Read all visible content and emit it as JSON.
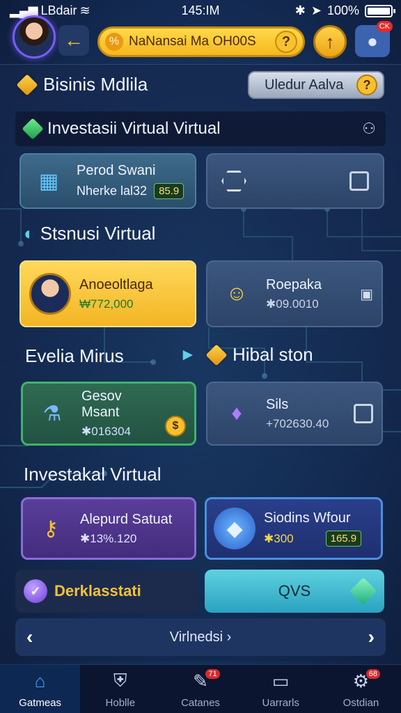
{
  "status_bar": {
    "carrier": "LBdair",
    "time": "145:IM",
    "battery": "100%"
  },
  "header": {
    "search_text": "NaNansai Ma OH00S",
    "search_icon_glyph": "%",
    "help_glyph": "?",
    "up_glyph": "↑",
    "profile_badge": "CK"
  },
  "business": {
    "title": "Bisinis Mdlila",
    "button_label": "Uledur Aalva",
    "button_glyph": "?"
  },
  "virtual_bar": {
    "label": "Investasii Virtual Virtual"
  },
  "row1": {
    "card1": {
      "title": "Perod Swani",
      "subtitle": "Nherke lal32",
      "chip": "85.9"
    }
  },
  "section2": {
    "title": "Stsnusi Virtual"
  },
  "row2": {
    "card1": {
      "title": "Anoeoltlaga",
      "value": "₩772,000"
    },
    "card2": {
      "title": "Roepaka",
      "value": "✱09.0010"
    }
  },
  "section3": {
    "left_title": "Evelia Mirus",
    "right_title": "Hibal ston"
  },
  "row3": {
    "card1": {
      "title": "Gesov Msant",
      "value": "✱016304"
    },
    "card2": {
      "title": "Sils",
      "value": "+702630.40"
    }
  },
  "section4": {
    "title": "Investakal Virtual"
  },
  "row4": {
    "card1": {
      "title": "Alepurd Satuat",
      "value": "✱13%.120"
    },
    "card2": {
      "title": "Siodins Wfour",
      "value": "✱300",
      "chip": "165.9"
    }
  },
  "actions": {
    "left_label": "Derklasstati",
    "right_label": "QVS"
  },
  "pager": {
    "label": "Virlnedsi",
    "prev": "‹",
    "next": "›"
  },
  "nav": [
    {
      "label": "Gatmeas",
      "icon": "home-icon",
      "badge": ""
    },
    {
      "label": "Hoblle",
      "icon": "shield-icon",
      "badge": ""
    },
    {
      "label": "Catanes",
      "icon": "tag-icon",
      "badge": "71"
    },
    {
      "label": "Uarrarls",
      "icon": "monitor-icon",
      "badge": ""
    },
    {
      "label": "Ostdian",
      "icon": "gear-icon",
      "badge": "68"
    }
  ],
  "colors": {
    "accent": "#f5b81e",
    "panel": "#0f1b36",
    "active_nav": "#3aa7ff"
  }
}
